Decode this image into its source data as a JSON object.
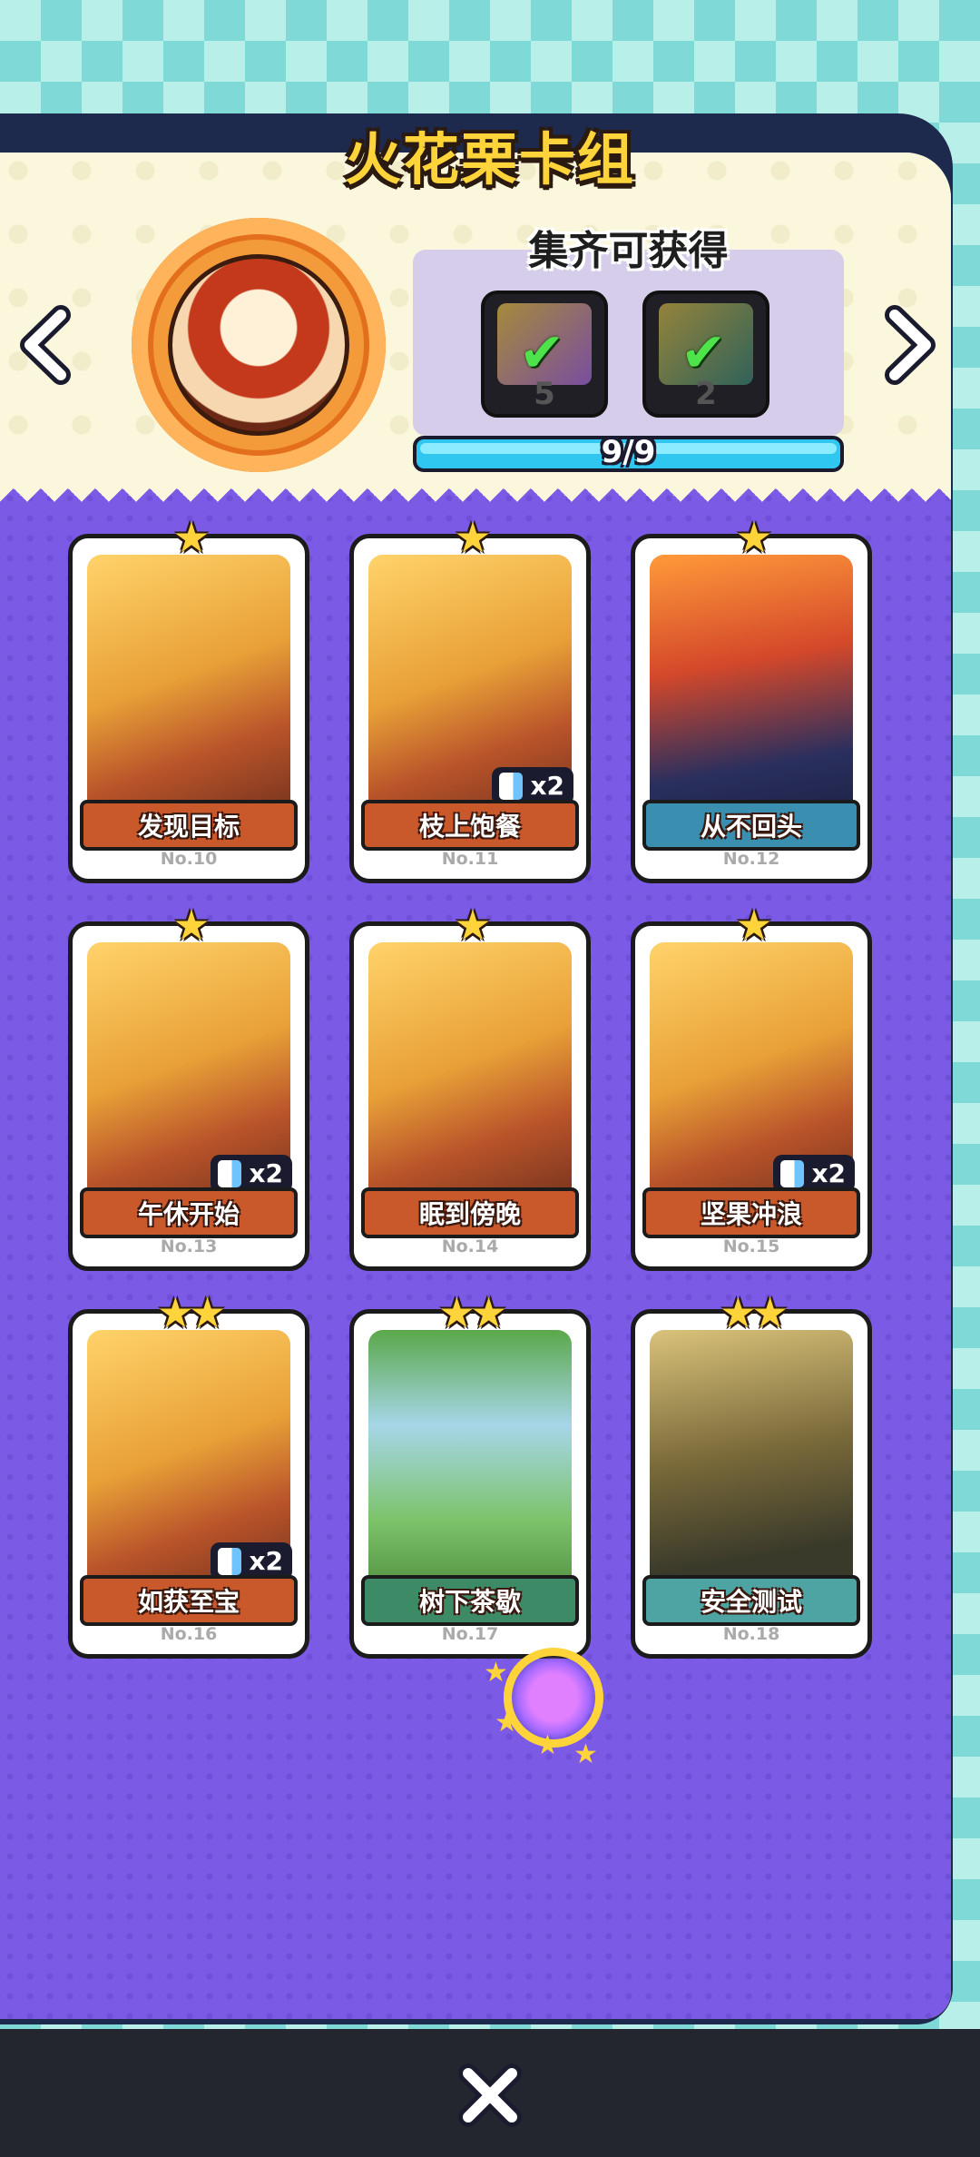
{
  "title": "火花栗卡组",
  "reward": {
    "heading": "集齐可获得",
    "items": [
      {
        "count": "5",
        "icon": "check-icon"
      },
      {
        "count": "2",
        "icon": "check-icon"
      }
    ],
    "progress_text": "9/9",
    "progress_fraction": 1.0
  },
  "cards": [
    {
      "name": "发现目标",
      "no": "No.10",
      "stars": "★",
      "dup": "",
      "theme": "orange"
    },
    {
      "name": "枝上饱餐",
      "no": "No.11",
      "stars": "★",
      "dup": "x2",
      "theme": "orange"
    },
    {
      "name": "从不回头",
      "no": "No.12",
      "stars": "★",
      "dup": "",
      "theme": "blue"
    },
    {
      "name": "午休开始",
      "no": "No.13",
      "stars": "★",
      "dup": "x2",
      "theme": "orange"
    },
    {
      "name": "眠到傍晚",
      "no": "No.14",
      "stars": "★",
      "dup": "",
      "theme": "orange"
    },
    {
      "name": "坚果冲浪",
      "no": "No.15",
      "stars": "★",
      "dup": "x2",
      "theme": "orange"
    },
    {
      "name": "如获至宝",
      "no": "No.16",
      "stars": "★★",
      "dup": "x2",
      "theme": "orange"
    },
    {
      "name": "树下茶歇",
      "no": "No.17",
      "stars": "★★",
      "dup": "",
      "theme": "green"
    },
    {
      "name": "安全测试",
      "no": "No.18",
      "stars": "★★",
      "dup": "",
      "theme": "teal"
    }
  ],
  "colors": {
    "title": "#ffd43a",
    "panel_purple": "#7b5ae6",
    "progress": "#2fc6f0"
  }
}
